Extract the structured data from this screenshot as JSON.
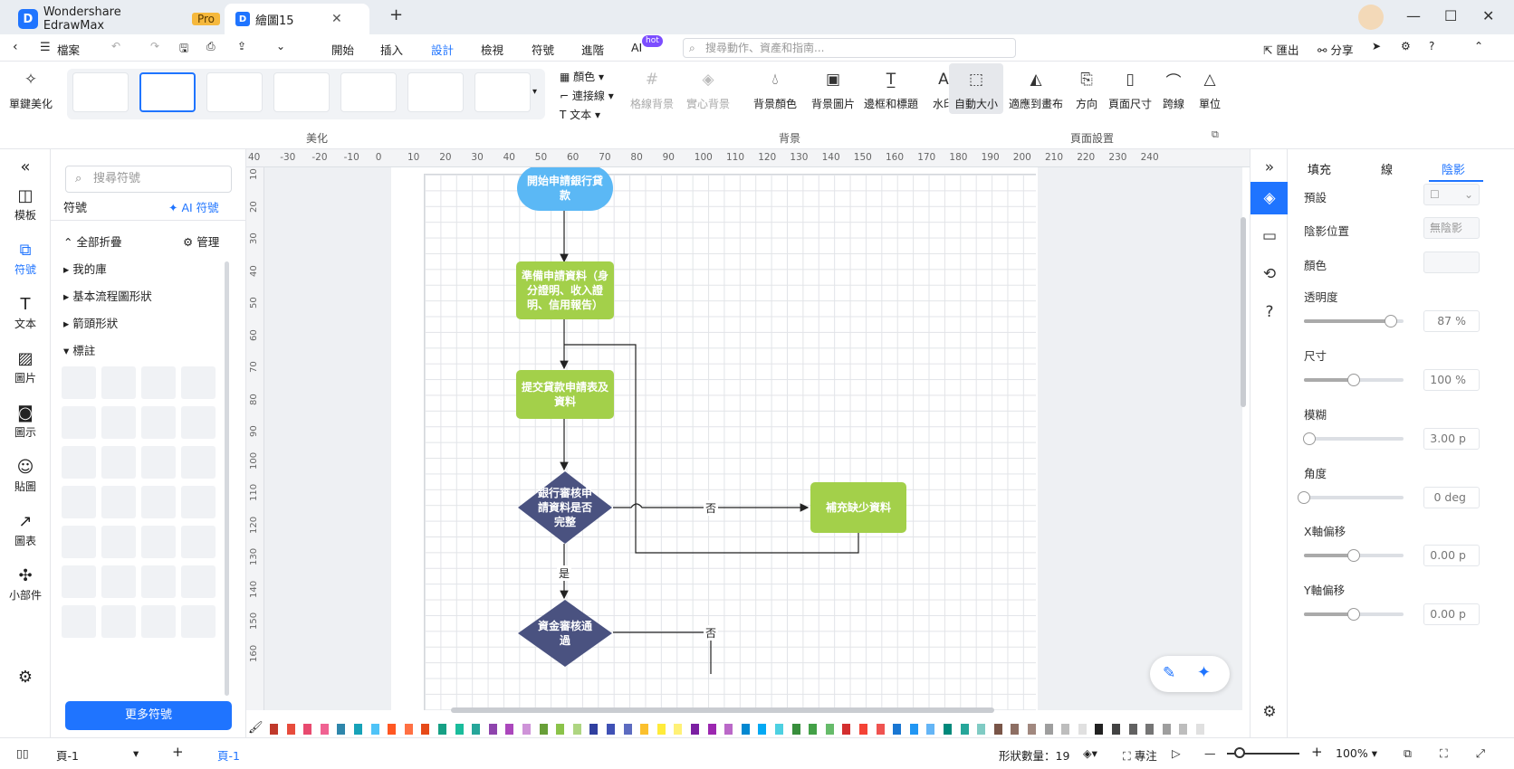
{
  "titlebar": {
    "app_name": "Wondershare EdrawMax",
    "pro_badge": "Pro",
    "doc_tab": "繪圖15",
    "new_tab": "+"
  },
  "menubar": {
    "file": "檔案",
    "tabs": [
      "開始",
      "插入",
      "設計",
      "檢視",
      "符號",
      "進階",
      "AI"
    ],
    "ai_badge": "hot",
    "search_placeholder": "搜尋動作、資產和指南...",
    "export": "匯出",
    "share": "分享"
  },
  "ribbon": {
    "beautify": "單鍵美化",
    "group_beautify": "美化",
    "color": "顏色",
    "connector": "連接線",
    "text": "文本",
    "grid_bg": "格線背景",
    "solid_bg": "實心背景",
    "bg_color": "背景顏色",
    "bg_image": "背景圖片",
    "border_title": "邊框和標題",
    "watermark": "水印",
    "group_background": "背景",
    "auto_size": "自動大小",
    "fit_canvas": "適應到畫布",
    "direction": "方向",
    "page_size": "頁面尺寸",
    "jump_line": "跨線",
    "unit": "單位",
    "group_page": "頁面設置"
  },
  "leftbar": {
    "items": [
      "模板",
      "符號",
      "文本",
      "圖片",
      "圖示",
      "貼圖",
      "圖表",
      "小部件"
    ]
  },
  "sympanel": {
    "search_placeholder": "搜尋符號",
    "title": "符號",
    "ai_symbol": "AI 符號",
    "collapse_all": "全部折疊",
    "manage": "管理",
    "categories": [
      "我的庫",
      "基本流程圖形狀",
      "箭頭形狀",
      "標註"
    ],
    "more_button": "更多符號"
  },
  "ruler": {
    "top": [
      "40",
      "-30",
      "-20",
      "-10",
      "0",
      "10",
      "20",
      "30",
      "40",
      "50",
      "60",
      "70",
      "80",
      "90",
      "100",
      "110",
      "120",
      "130",
      "140",
      "150",
      "160",
      "170",
      "180",
      "190",
      "200",
      "210",
      "220",
      "230",
      "240"
    ],
    "left": [
      "10",
      "20",
      "30",
      "40",
      "50",
      "60",
      "70",
      "80",
      "90",
      "100",
      "110",
      "120",
      "130",
      "140",
      "150",
      "160"
    ]
  },
  "flowchart": {
    "start": "開始申請銀行貸款",
    "prepare": "準備申請資料（身分證明、收入證明、信用報告）",
    "submit": "提交貸款申請表及資料",
    "review": "銀行審核申請資料是否完整",
    "supplement": "補充缺少資料",
    "fund": "資金審核通過",
    "no1": "否",
    "yes1": "是",
    "no2": "否"
  },
  "colors": {
    "accent": "#1f74ff",
    "green_node": "#a3d04a",
    "blue_node": "#5bb8f5",
    "diamond": "#4a5280"
  },
  "props": {
    "tabs": [
      "填充",
      "線",
      "陰影"
    ],
    "preset": "預設",
    "shadow_pos": "陰影位置",
    "shadow_pos_value": "無陰影",
    "color": "顏色",
    "opacity": "透明度",
    "opacity_value": "87 %",
    "size": "尺寸",
    "size_value": "100 %",
    "blur": "模糊",
    "blur_value": "3.00 p",
    "angle": "角度",
    "angle_value": "0 deg",
    "x_offset": "X軸偏移",
    "x_offset_value": "0.00 p",
    "y_offset": "Y軸偏移",
    "y_offset_value": "0.00 p",
    "opacity_level": 0.87,
    "size_level": 0.5,
    "blur_level": 0.05,
    "angle_level": 0.0,
    "x_level": 0.5,
    "y_level": 0.5
  },
  "statusbar": {
    "page_select": "頁-1",
    "add_page": "+",
    "page_tab": "頁-1",
    "shape_count": "形狀數量：19",
    "focus": "專注",
    "zoom": "100%"
  }
}
